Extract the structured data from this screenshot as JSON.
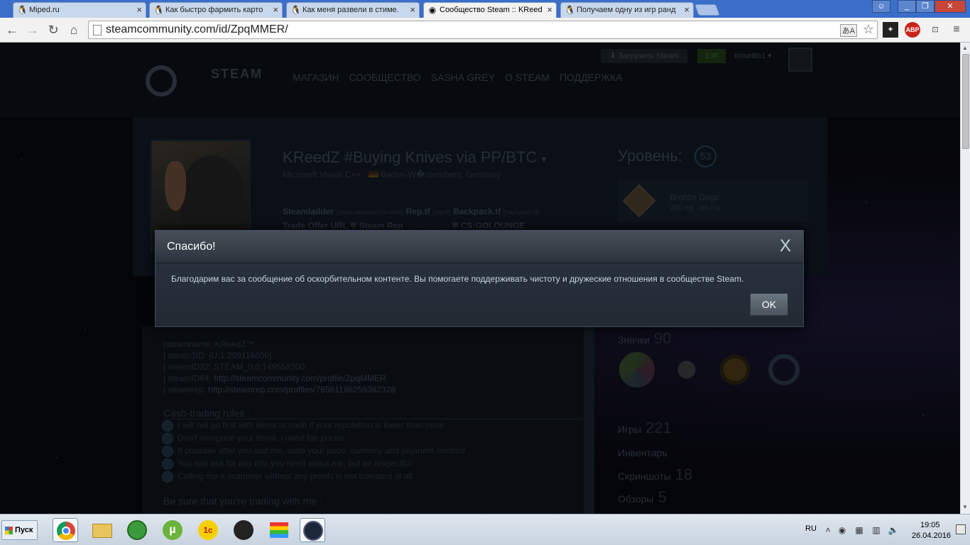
{
  "browser": {
    "tabs": [
      {
        "title": "Miped.ru",
        "icon": "miped-icon",
        "active": false
      },
      {
        "title": "Как быстро фармить карто",
        "icon": "miped-icon",
        "active": false
      },
      {
        "title": "Как меня развели в стиме.",
        "icon": "miped-icon",
        "active": false
      },
      {
        "title": "Сообщество Steam :: KReed",
        "icon": "steam-icon",
        "active": true
      },
      {
        "title": "Получаем одну из игр ранд",
        "icon": "miped-icon",
        "active": false
      }
    ],
    "url": "steamcommunity.com/id/ZpqMMER/",
    "extensions": {
      "abp": "ABP"
    }
  },
  "steam_header": {
    "logo_text": "STEAM",
    "menu": [
      "МАГАЗИН",
      "СООБЩЕСТВО",
      "SASHA GREY",
      "О STEAM",
      "ПОДДЕРЖКА"
    ],
    "install_label": "Загрузить Steam",
    "notifications_count": "1",
    "account_name": "timurillo1"
  },
  "profile": {
    "persona_name": "KReedZ #Buying Knives via PP/BTC",
    "status_line": "Microsoft Visual C++",
    "location": "Baden-W�rttemberg, Germany",
    "links_line1": [
      {
        "name": "Steamladder",
        "url": "[www.steamladder.com]"
      },
      {
        "name": "Rep.tf",
        "url": "[rep.tf]"
      },
      {
        "name": "Backpack.tf",
        "url": "[backpack.tf]"
      }
    ],
    "links_line2": [
      {
        "name": "Trade Offer URL",
        "url": ""
      },
      {
        "name": "Steam Rep",
        "url": "[steamrep.com]"
      },
      {
        "name": "CS:GOLOUNGE",
        "url": ""
      }
    ],
    "level_label": "Уровень:",
    "level": "53",
    "favorite_badge": {
      "name": "Bronze Dogs",
      "xp": "200 ед. опыта"
    }
  },
  "summary": {
    "lines": [
      {
        "prefix": "|steamname: KReedZ™",
        "link": ""
      },
      {
        "prefix": "| steam3ID: [U:1:299116600]",
        "link": ""
      },
      {
        "prefix": "| steamID32: STEAM_0:0:149558300",
        "link": ""
      },
      {
        "prefix": "| steamID64: ",
        "link": "http://steamcommunity.com/profile/ZpqMMER"
      },
      {
        "prefix": "| steamrep: ",
        "link": "http://steamrep.com/profiles/76561198259382328"
      }
    ],
    "rules_heading": "Cash-trading rules :",
    "rules": [
      "I will not go first with items or cash if your reputation is lower than mine",
      "Don't overprice your items, i need fair prices",
      "If possible after you add me, state your price, currency and payment method",
      "You can ask for any info you need about me, but be respectful",
      "Calling me a scammer without any proofs is not tolerated at all"
    ],
    "footer_heading": "Be sure that you're trading with me :"
  },
  "stats": {
    "badges_label": "Значки",
    "badges_count": "90",
    "games_label": "Игры",
    "games_count": "221",
    "inventory_label": "Инвентарь",
    "screenshots_label": "Скриншоты",
    "screenshots_count": "18",
    "reviews_label": "Обзоры",
    "reviews_count": "5"
  },
  "modal": {
    "title": "Спасибо!",
    "close_glyph": "X",
    "message": "Благодарим вас за сообщение об оскорбительном контенте. Вы помогаете поддерживать чистоту и дружеские отношения в сообществе Steam.",
    "ok_label": "OK"
  },
  "taskbar": {
    "start_label": "Пуск",
    "lang": "RU",
    "time": "19:05",
    "date": "26.04.2016"
  }
}
